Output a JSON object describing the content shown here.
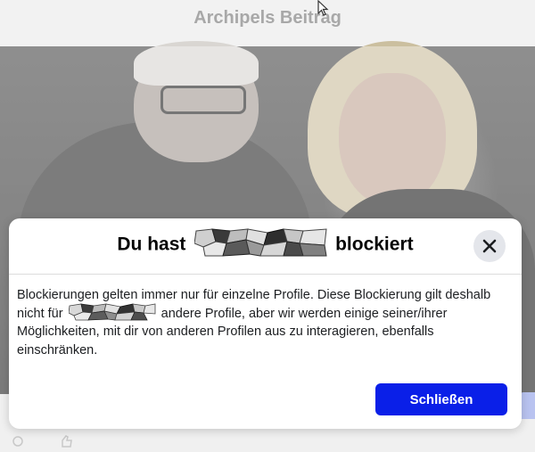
{
  "header": {
    "title": "Archipels Beitrag"
  },
  "dialog": {
    "heading_prefix": "Du hast",
    "heading_suffix": "blockiert",
    "body_part1": "Blockierungen gelten immer nur für einzelne Profile. Diese Blockierung gilt deshalb nicht für",
    "body_part2": "andere Profile, aber wir werden einige seiner/ihrer Möglichkeiten, mit dir von anderen Profilen aus zu interagieren, ebenfalls einschränken.",
    "close_icon": "close-icon",
    "button_label": "Schließen"
  },
  "colors": {
    "accent": "#0a1fe8",
    "close_bg": "#e4e6eb",
    "title_gray": "#a8a8a8"
  }
}
